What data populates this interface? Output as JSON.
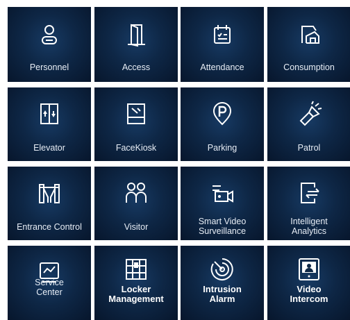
{
  "tiles": [
    {
      "label": "Personnel",
      "icon": "personnel-icon"
    },
    {
      "label": "Access",
      "icon": "door-icon"
    },
    {
      "label": "Attendance",
      "icon": "calendar-icon"
    },
    {
      "label": "Consumption",
      "icon": "shop-icon"
    },
    {
      "label": "Elevator",
      "icon": "elevator-icon"
    },
    {
      "label": "FaceKiosk",
      "icon": "face-kiosk-icon"
    },
    {
      "label": "Parking",
      "icon": "parking-icon"
    },
    {
      "label": "Patrol",
      "icon": "flashlight-icon"
    },
    {
      "label": "Entrance Control",
      "icon": "turnstile-icon"
    },
    {
      "label": "Visitor",
      "icon": "visitor-icon"
    },
    {
      "label": "Smart Video\nSurveillance",
      "icon": "video-camera-icon"
    },
    {
      "label": "Intelligent\nAnalytics",
      "icon": "analytics-icon"
    },
    {
      "label": "Service\nCenter",
      "icon": "monitor-chart-icon"
    },
    {
      "label": "Locker\nManagement",
      "icon": "locker-icon"
    },
    {
      "label": "Intrusion\nAlarm",
      "icon": "radar-icon"
    },
    {
      "label": "Video\nIntercom",
      "icon": "intercom-icon"
    }
  ]
}
